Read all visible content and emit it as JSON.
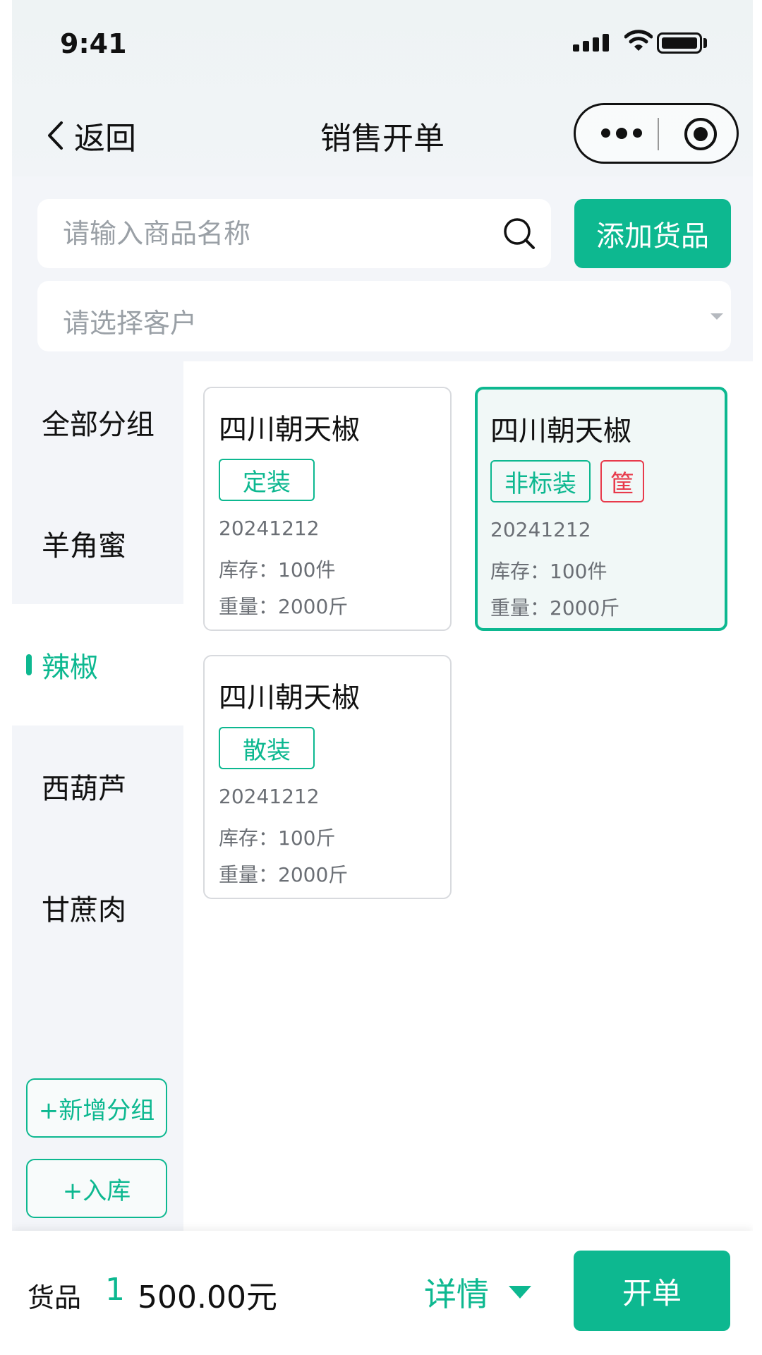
{
  "status_bar": {
    "time": "9:41"
  },
  "nav": {
    "back_label": "返回",
    "title": "销售开单"
  },
  "search": {
    "placeholder": "请输入商品名称",
    "add_button": "添加货品"
  },
  "customer": {
    "placeholder": "请选择客户"
  },
  "accent_color": "#0db890",
  "sidebar": {
    "groups": [
      {
        "label": "全部分组",
        "active": false
      },
      {
        "label": "羊角蜜",
        "active": false
      },
      {
        "label": "辣椒",
        "active": true
      },
      {
        "label": "西葫芦",
        "active": false
      },
      {
        "label": "甘蔗肉",
        "active": false
      }
    ],
    "add_group_button": "+新增分组",
    "stock_in_button": "+入库"
  },
  "products": [
    {
      "name": "四川朝天椒",
      "tags": [
        "定装"
      ],
      "batch": "20241212",
      "stock": "库存：100件",
      "weight": "重量：2000斤",
      "selected": false
    },
    {
      "name": "四川朝天椒",
      "tags": [
        "非标装",
        "筐"
      ],
      "batch": "20241212",
      "stock": "库存：100件",
      "weight": "重量：2000斤",
      "selected": true
    },
    {
      "name": "四川朝天椒",
      "tags": [
        "散装"
      ],
      "batch": "20241212",
      "stock": "库存：100斤",
      "weight": "重量：2000斤",
      "selected": false
    }
  ],
  "bottom_bar": {
    "goods_label": "货品",
    "goods_count": "1",
    "amount": "500.00元",
    "detail_label": "详情",
    "submit_label": "开单"
  }
}
